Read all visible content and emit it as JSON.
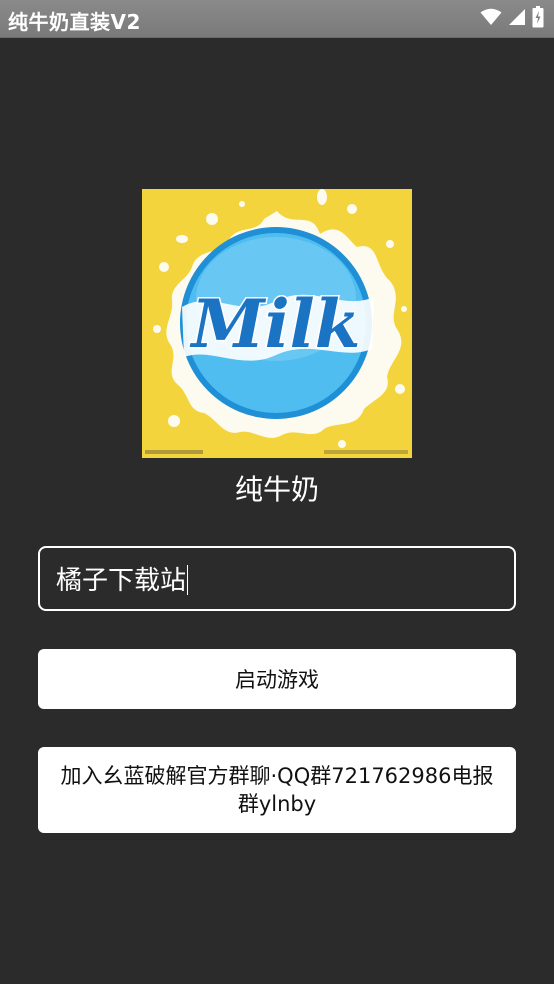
{
  "status_bar": {
    "app_title": "纯牛奶直装V2",
    "icons": [
      "wifi-icon",
      "signal-icon",
      "battery-icon"
    ]
  },
  "logo": {
    "word": "Milk",
    "name": "纯牛奶"
  },
  "input": {
    "value": "橘子下载站"
  },
  "buttons": {
    "start_label": "启动游戏",
    "join_label": "加入幺蓝破解官方群聊·QQ群721762986电报群ylnby"
  },
  "colors": {
    "background": "#2b2b2b",
    "status_bar": "#808080",
    "logo_yellow": "#f4d43c",
    "logo_blue": "#2aa3e6",
    "button": "#ffffff",
    "text_light": "#ffffff"
  }
}
